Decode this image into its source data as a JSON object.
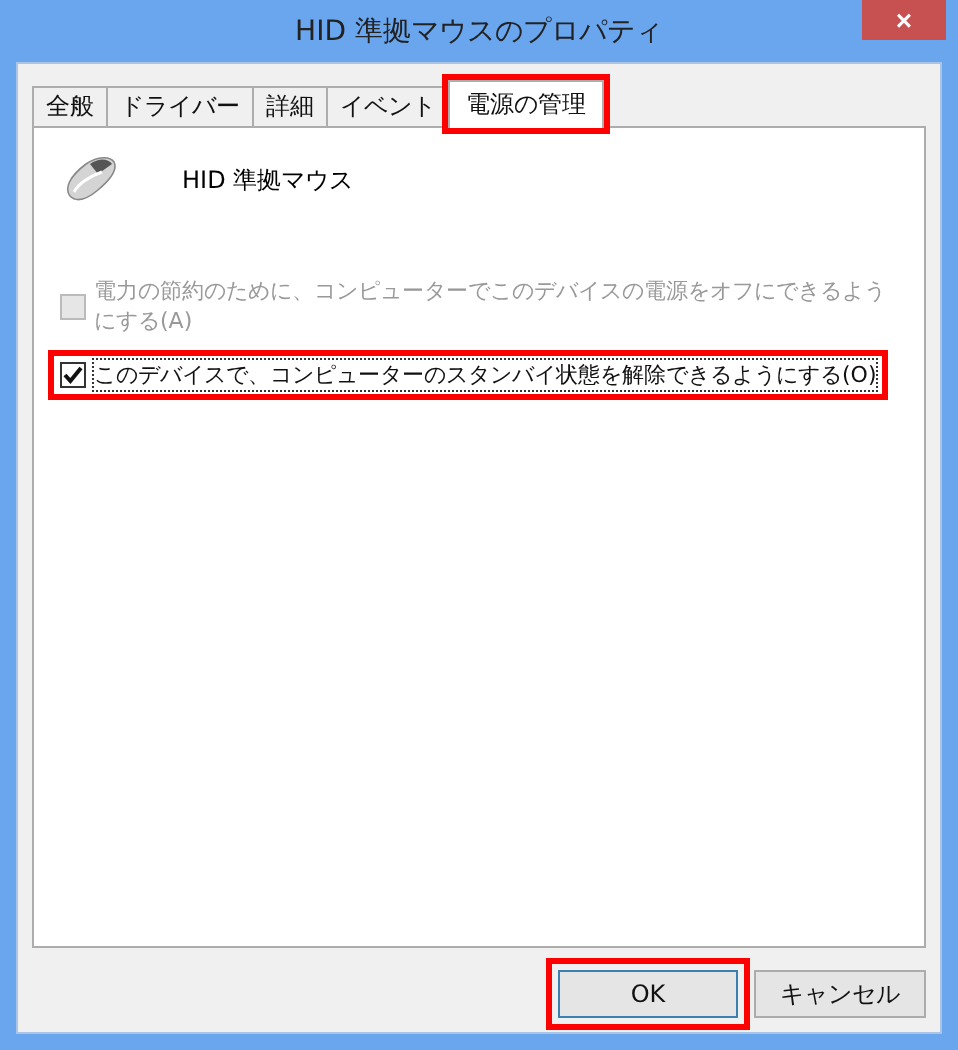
{
  "window": {
    "title": "HID 準拠マウスのプロパティ",
    "close": "×"
  },
  "tabs": [
    {
      "label": "全般",
      "selected": false,
      "highlighted": false
    },
    {
      "label": "ドライバー",
      "selected": false,
      "highlighted": false
    },
    {
      "label": "詳細",
      "selected": false,
      "highlighted": false
    },
    {
      "label": "イベント",
      "selected": false,
      "highlighted": false
    },
    {
      "label": "電源の管理",
      "selected": true,
      "highlighted": true
    }
  ],
  "device": {
    "name": "HID 準拠マウス"
  },
  "options": [
    {
      "label": "電力の節約のために、コンピューターでこのデバイスの電源をオフにできるようにする(A)",
      "checked": false,
      "disabled": true,
      "highlighted": false
    },
    {
      "label": "このデバイスで、コンピューターのスタンバイ状態を解除できるようにする(O)",
      "checked": true,
      "disabled": false,
      "highlighted": true
    }
  ],
  "buttons": [
    {
      "label": "OK",
      "highlighted": true
    },
    {
      "label": "キャンセル",
      "highlighted": false
    }
  ]
}
